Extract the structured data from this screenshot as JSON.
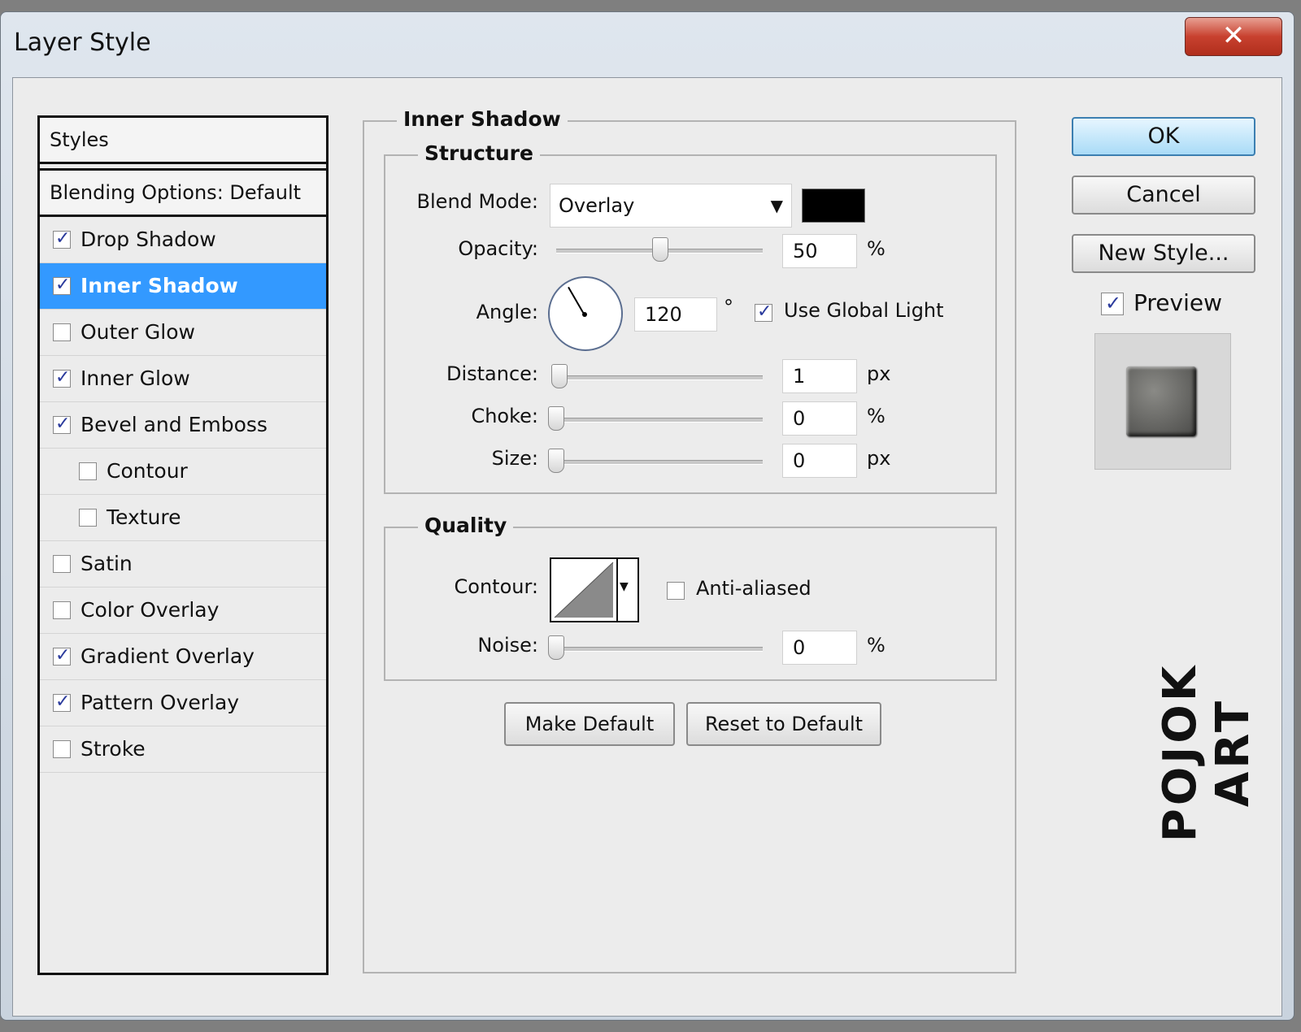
{
  "window": {
    "title": "Layer Style",
    "close_icon": "close-icon"
  },
  "styles_list": {
    "header": "Styles",
    "blending": "Blending Options: Default",
    "items": [
      {
        "label": "Drop Shadow",
        "checked": true
      },
      {
        "label": "Inner Shadow",
        "checked": true,
        "selected": true
      },
      {
        "label": "Outer Glow",
        "checked": false
      },
      {
        "label": "Inner Glow",
        "checked": true
      },
      {
        "label": "Bevel and Emboss",
        "checked": true
      },
      {
        "label": "Contour",
        "checked": false,
        "sub": true
      },
      {
        "label": "Texture",
        "checked": false,
        "sub": true
      },
      {
        "label": "Satin",
        "checked": false
      },
      {
        "label": "Color Overlay",
        "checked": false
      },
      {
        "label": "Gradient Overlay",
        "checked": true
      },
      {
        "label": "Pattern Overlay",
        "checked": true
      },
      {
        "label": "Stroke",
        "checked": false
      }
    ]
  },
  "panel": {
    "title": "Inner Shadow",
    "structure": {
      "title": "Structure",
      "blend_mode_label": "Blend Mode:",
      "blend_mode_value": "Overlay",
      "shadow_color": "#000000",
      "opacity_label": "Opacity:",
      "opacity_value": "50",
      "opacity_unit": "%",
      "opacity_level": 0.5,
      "angle_label": "Angle:",
      "angle_value": "120",
      "angle_unit": "°",
      "use_global_light_label": "Use Global Light",
      "use_global_light_checked": true,
      "distance_label": "Distance:",
      "distance_value": "1",
      "distance_unit": "px",
      "choke_label": "Choke:",
      "choke_value": "0",
      "choke_unit": "%",
      "size_label": "Size:",
      "size_value": "0",
      "size_unit": "px"
    },
    "quality": {
      "title": "Quality",
      "contour_label": "Contour:",
      "anti_aliased_label": "Anti-aliased",
      "anti_aliased_checked": false,
      "noise_label": "Noise:",
      "noise_value": "0",
      "noise_unit": "%"
    },
    "make_default": "Make Default",
    "reset_default": "Reset to Default"
  },
  "actions": {
    "ok": "OK",
    "cancel": "Cancel",
    "new_style": "New Style...",
    "preview_label": "Preview",
    "preview_checked": true
  },
  "watermark": "POJOK ART"
}
